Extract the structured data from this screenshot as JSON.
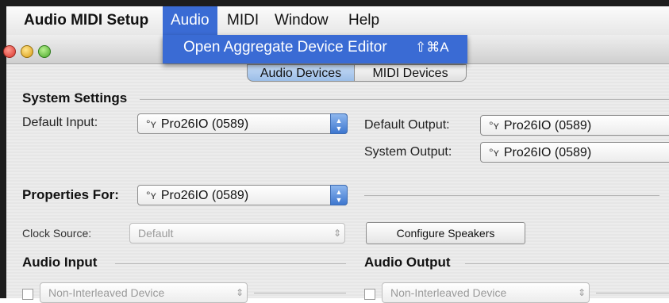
{
  "menubar": {
    "app_name": "Audio MIDI Setup",
    "items": [
      "Audio",
      "MIDI",
      "Window",
      "Help"
    ]
  },
  "dropdown": {
    "item_label": "Open Aggregate Device Editor",
    "item_shortcut": "⇧⌘A"
  },
  "window": {
    "tabs": [
      "Audio Devices",
      "MIDI Devices"
    ],
    "selected_tab": "Audio Devices"
  },
  "system_settings": {
    "title": "System Settings",
    "default_input_label": "Default Input:",
    "default_input_value": "Pro26IO (0589)",
    "default_output_label": "Default Output:",
    "default_output_value": "Pro26IO (0589)",
    "system_output_label": "System Output:",
    "system_output_value": "Pro26IO (0589)"
  },
  "properties": {
    "label": "Properties For:",
    "value": "Pro26IO (0589)",
    "clock_source_label": "Clock Source:",
    "clock_source_value": "Default",
    "configure_speakers_label": "Configure Speakers"
  },
  "audio_input": {
    "title": "Audio Input",
    "format_value": "Non-Interleaved Device"
  },
  "audio_output": {
    "title": "Audio Output",
    "format_value": "Non-Interleaved Device"
  },
  "icons": {
    "device": "audio-device-icon",
    "popup_arrows": "up-down-arrows-icon"
  },
  "colors": {
    "menu_highlight": "#3a6bd4",
    "popup_arrow_blue": "#3e77cf",
    "selected_tab": "#9bbde7"
  }
}
